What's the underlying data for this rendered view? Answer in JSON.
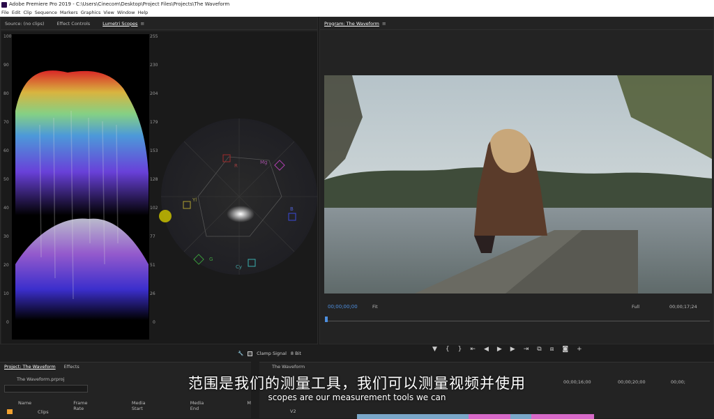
{
  "titlebar": {
    "title": "Adobe Premiere Pro 2019 - C:\\Users\\Cinecom\\Desktop\\Project Files\\Projects\\The Waveform"
  },
  "menubar": {
    "items": [
      "File",
      "Edit",
      "Clip",
      "Sequence",
      "Markers",
      "Graphics",
      "View",
      "Window",
      "Help"
    ]
  },
  "source_panel": {
    "tabs": [
      "Source: (no clips)",
      "Effect Controls",
      "Lumetri Scopes"
    ],
    "active_tab": "Lumetri Scopes",
    "left_scale": [
      "100",
      "90",
      "80",
      "70",
      "60",
      "50",
      "40",
      "30",
      "20",
      "10",
      "0"
    ],
    "right_scale": [
      "255",
      "230",
      "204",
      "179",
      "153",
      "128",
      "102",
      "77",
      "51",
      "26",
      "0"
    ],
    "vectorscope_labels": {
      "r": "R",
      "mg": "Mg",
      "b": "B",
      "cy": "Cy",
      "g": "G",
      "yl": "Yl"
    },
    "clamp_signal_label": "Clamp Signal",
    "bit_depth": "8 Bit"
  },
  "program_panel": {
    "title": "Program: The Waveform",
    "timecode_in": "00;00;00;00",
    "fit": "Fit",
    "quality": "Full",
    "duration": "00;00;17;24"
  },
  "project_panel": {
    "tabs": [
      "Project: The Waveform",
      "Effects"
    ],
    "file": "The Waveform.prproj",
    "columns": [
      "Name",
      "Frame Rate",
      "Media Start",
      "Media End",
      "M"
    ],
    "items": [
      "Clips"
    ]
  },
  "timeline_panel": {
    "tab": "The Waveform",
    "times": [
      "00;00;16;00",
      "00;00;20;00",
      "00;00;"
    ],
    "track": "V2"
  },
  "subtitles": {
    "cn": "范围是我们的测量工具，我们可以测量视频并使用",
    "en": "scopes are our measurement tools we can"
  }
}
